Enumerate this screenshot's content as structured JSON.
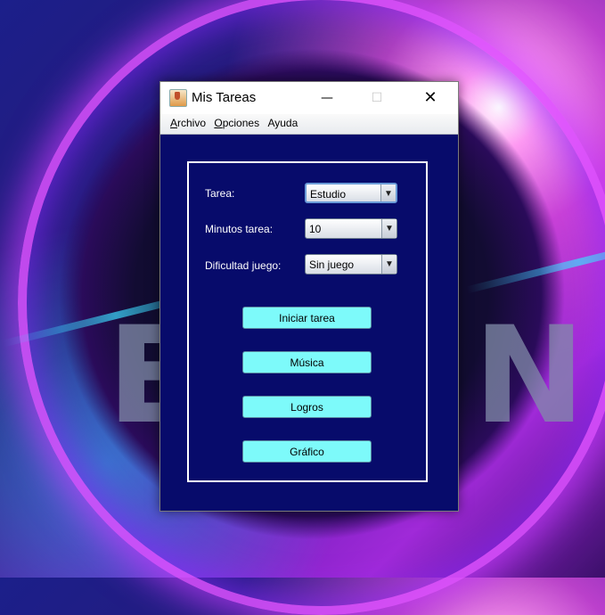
{
  "window": {
    "title": "Mis Tareas",
    "minimize_glyph": "—",
    "maximize_glyph": "☐",
    "close_glyph": "✕"
  },
  "menubar": {
    "items": [
      {
        "mnemonic": "A",
        "rest": "rchivo"
      },
      {
        "mnemonic": "O",
        "rest": "pciones"
      },
      {
        "mnemonic": "",
        "rest": "Ayuda"
      }
    ]
  },
  "form": {
    "task_label": "Tarea:",
    "task_value": "Estudio",
    "minutes_label": "Minutos tarea:",
    "minutes_value": "10",
    "difficulty_label": "Dificultad juego:",
    "difficulty_value": "Sin juego",
    "dropdown_arrow": "▼"
  },
  "buttons": {
    "start": "Iniciar tarea",
    "music": "Música",
    "achievements": "Logros",
    "chart": "Gráfico"
  },
  "colors": {
    "content_bg": "#070b6b",
    "button_bg": "#7dfafa",
    "panel_border": "#ffffff"
  }
}
